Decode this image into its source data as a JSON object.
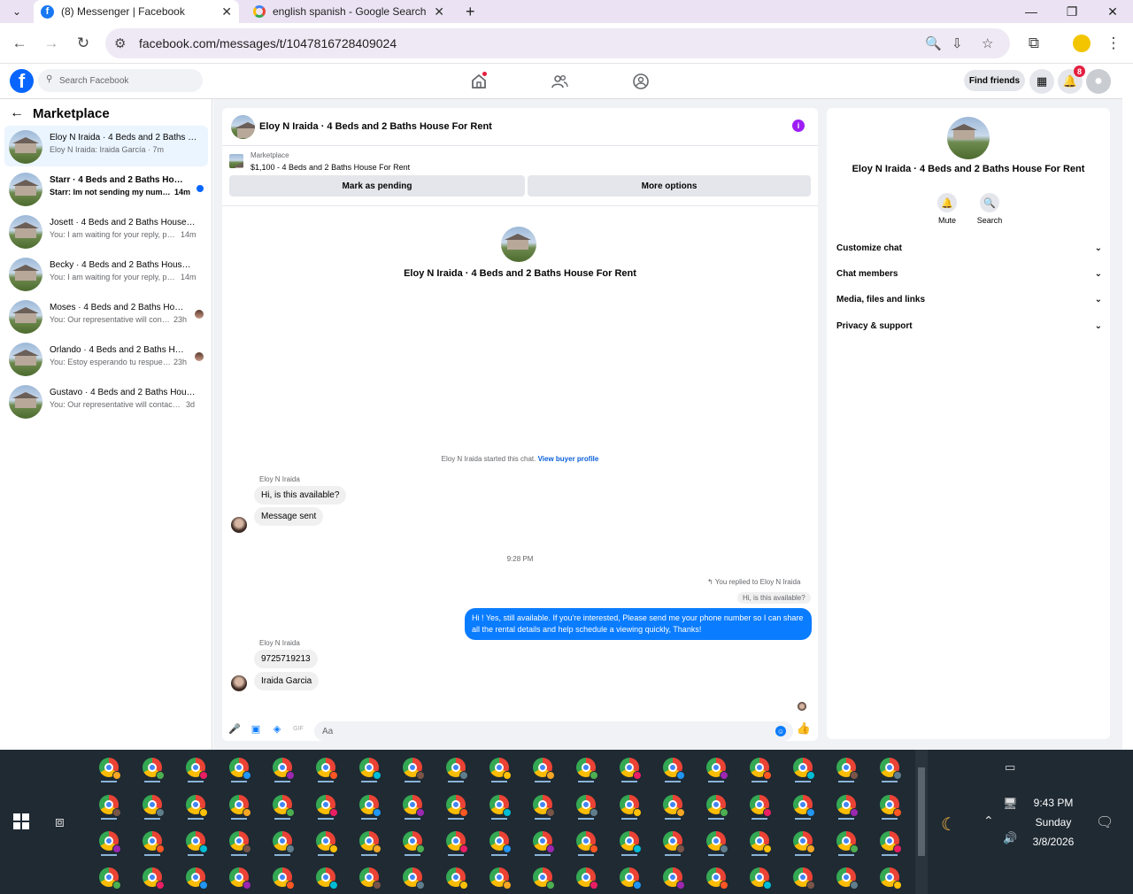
{
  "browser": {
    "tabs": [
      {
        "title": "(8) Messenger | Facebook",
        "active": true
      },
      {
        "title": "english spanish - Google Search",
        "active": false
      }
    ],
    "url": "facebook.com/messages/t/1047816728409024"
  },
  "fb": {
    "search_placeholder": "Search Facebook",
    "find_friends": "Find friends",
    "notification_count": "8"
  },
  "sidebar": {
    "title": "Marketplace",
    "conversations": [
      {
        "name": "Eloy N Iraida · 4 Beds and 2 Baths House For Rent",
        "snippet": "Eloy N Iraida: Iraida García · 7m",
        "time": "",
        "selected": true,
        "unread": false
      },
      {
        "name": "Starr · 4 Beds and 2 Baths House For Rent",
        "snippet": "Starr: Im not sending my number...",
        "time": "14m",
        "selected": false,
        "unread": true
      },
      {
        "name": "Josett · 4 Beds and 2 Baths House For Rent",
        "snippet": "You: I am waiting for your reply, ple...",
        "time": "14m",
        "selected": false,
        "unread": false
      },
      {
        "name": "Becky · 4 Beds and 2 Baths House For Rent",
        "snippet": "You: I am waiting for your reply, ple...",
        "time": "14m",
        "selected": false,
        "unread": false
      },
      {
        "name": "Moses · 4 Beds and 2 Baths House For Rent",
        "snippet": "You: Our representative will conta...",
        "time": "23h",
        "selected": false,
        "unread": false
      },
      {
        "name": "Orlando · 4 Beds and 2 Baths House For Rent",
        "snippet": "You: Estoy esperando tu respuesta...",
        "time": "23h",
        "selected": false,
        "unread": false
      },
      {
        "name": "Gustavo · 4 Beds and 2 Baths House For Rent",
        "snippet": "You: Our representative will contact y...",
        "time": "3d",
        "selected": false,
        "unread": false
      }
    ]
  },
  "chat": {
    "title": "Eloy N Iraida · 4 Beds and 2 Baths House For Rent",
    "listing_label": "Marketplace",
    "listing_price": "$1,100 - 4 Beds and 2 Baths House For Rent",
    "mark_pending": "Mark as pending",
    "more_options": "More options",
    "intro_name": "Eloy N Iraida · 4 Beds and 2 Baths House For Rent",
    "started_text": "Eloy N Iraida started this chat.",
    "view_profile": "View buyer profile",
    "sender1": "Eloy N Iraida",
    "msg1": "Hi, is this available?",
    "msg2": "Message sent",
    "timestamp": "9:28 PM",
    "replied_to": "You replied to Eloy N Iraida",
    "quoted": "Hi, is this available?",
    "reply": "Hi ! Yes, still available. If you're interested, Please send me your phone number so I can share all the rental details and help schedule a viewing quickly, Thanks!",
    "sender2": "Eloy N Iraida",
    "msg3": "9725719213",
    "msg4": "Iraida Garcia",
    "input_placeholder": "Aa"
  },
  "details": {
    "name": "Eloy N Iraida · 4 Beds and 2 Baths House For Rent",
    "mute": "Mute",
    "search": "Search",
    "sections": [
      "Customize chat",
      "Chat members",
      "Media, files and links",
      "Privacy & support"
    ]
  },
  "taskbar": {
    "time": "9:43 PM",
    "day": "Sunday",
    "date": "3/8/2026"
  }
}
